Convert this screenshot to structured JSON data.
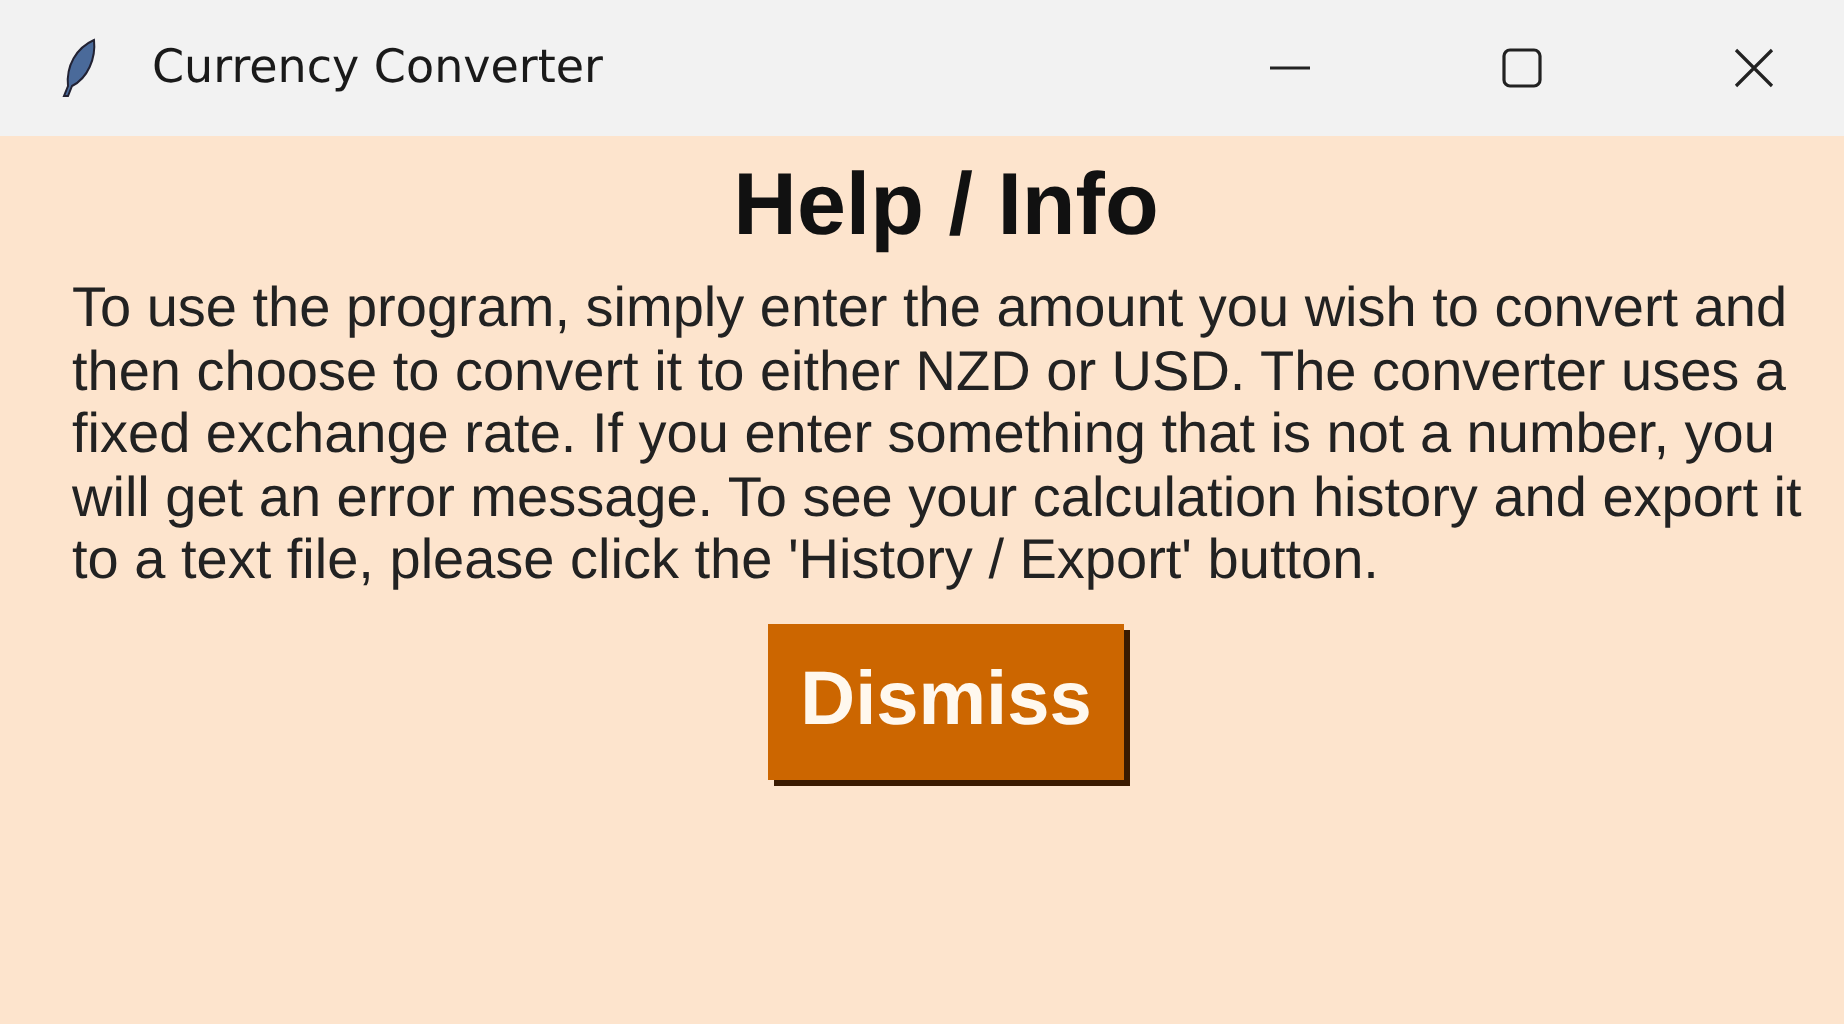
{
  "window": {
    "title": "Currency Converter"
  },
  "heading": "Help / Info",
  "body": "To use the program, simply enter the amount you wish to convert and then choose to convert it to either NZD or USD. The converter uses a fixed exchange rate. If you enter something that is not a number, you will get an error message. To see your calculation history and export it to a text file, please click the 'History / Export' button.",
  "buttons": [
    {
      "label": "Dismiss"
    }
  ]
}
